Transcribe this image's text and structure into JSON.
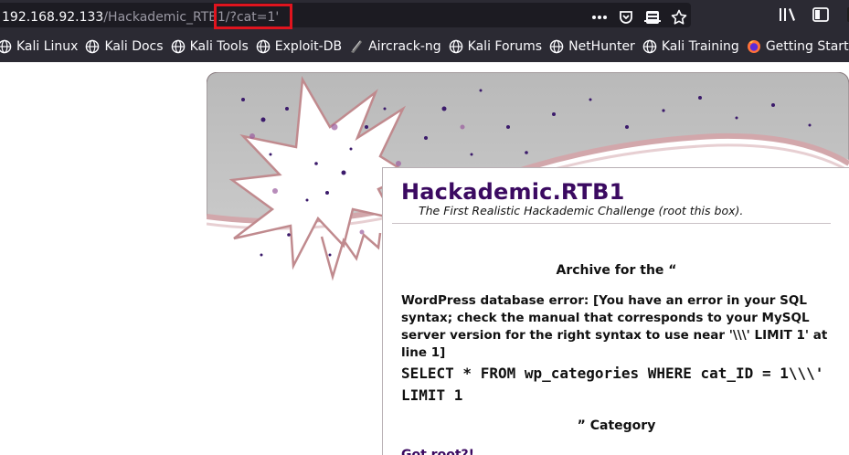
{
  "browser": {
    "url_host": "192.168.92.133",
    "url_path": "/Hackademic_RTB1/?cat=1'",
    "toolbar_icons": [
      "more-icon",
      "pocket-icon",
      "reader-view-icon",
      "bookmark-star-icon",
      "library-icon",
      "sidebar-icon",
      "extension-icon"
    ]
  },
  "bookmarks": [
    {
      "label": "Kali Linux",
      "icon": "globe-icon"
    },
    {
      "label": "Kali Docs",
      "icon": "globe-icon"
    },
    {
      "label": "Kali Tools",
      "icon": "globe-icon"
    },
    {
      "label": "Exploit-DB",
      "icon": "globe-icon"
    },
    {
      "label": "Aircrack-ng",
      "icon": "aircrack-icon"
    },
    {
      "label": "Kali Forums",
      "icon": "globe-icon"
    },
    {
      "label": "NetHunter",
      "icon": "globe-icon"
    },
    {
      "label": "Kali Training",
      "icon": "globe-icon"
    },
    {
      "label": "Getting Started",
      "icon": "firefox-icon"
    }
  ],
  "page": {
    "site_title": "Hackademic.RTB1",
    "site_description": "The First Realistic Hackademic Challenge (root this box).",
    "archive_title": "Archive for the “",
    "db_error": "WordPress database error: [You have an error in your SQL syntax; check the manual that corresponds to your MySQL server version for the right syntax to use near '\\\\\\' LIMIT 1' at line 1]",
    "db_query": "SELECT * FROM wp_categories WHERE cat_ID = 1\\\\\\' LIMIT 1",
    "category_line": "” Category",
    "post_link": "Got root?!"
  },
  "colors": {
    "chrome_bg": "#2b2a33",
    "url_field_bg": "#1c1b22",
    "highlight_box": "#e0141e",
    "title_purple": "#3b0a61"
  }
}
